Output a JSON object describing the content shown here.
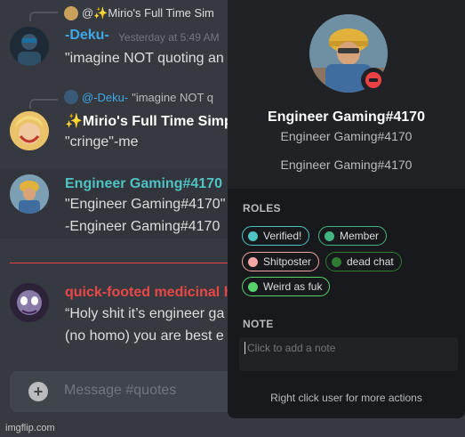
{
  "chat": {
    "messages": [
      {
        "reply_user": "@✨Mirio's Full Time Sim",
        "username": "-Deku-",
        "username_color": "#3ea8e8",
        "timestamp": "Yesterday at 5:49 AM",
        "lines": [
          "\"imagine NOT quoting an"
        ]
      },
      {
        "reply_user": "@-Deku-",
        "reply_text": "\"imagine NOT q",
        "username": "✨Mirio's Full Time Simp",
        "username_color": "#ffffff",
        "lines": [
          "\"cringe\"-me"
        ]
      },
      {
        "username": "Engineer Gaming#4170",
        "username_color": "#4fc3c3",
        "lines": [
          "\"Engineer Gaming#4170\"",
          "-Engineer Gaming#4170"
        ]
      },
      {
        "username": "quick-footed medicinal h",
        "username_color": "#e84848",
        "lines": [
          "“Holy shit it’s engineer ga",
          "(no homo) you are best e"
        ]
      }
    ],
    "composer_placeholder": "Message #quotes"
  },
  "profile": {
    "name": "Engineer Gaming#4170",
    "tag": "Engineer Gaming#4170",
    "custom_status": "Engineer Gaming#4170",
    "roles_header": "ROLES",
    "roles": [
      {
        "label": "Verified!",
        "color": "#4fc3c3"
      },
      {
        "label": "Member",
        "color": "#43b581"
      },
      {
        "label": "Shitposter",
        "color": "#f4a6a6"
      },
      {
        "label": "dead chat",
        "color": "#2e7d32"
      },
      {
        "label": "Weird as fuk",
        "color": "#57d36b"
      }
    ],
    "note_header": "NOTE",
    "note_placeholder": "Click to add a note",
    "hint": "Right click user for more actions"
  },
  "watermark": "imgflip.com"
}
